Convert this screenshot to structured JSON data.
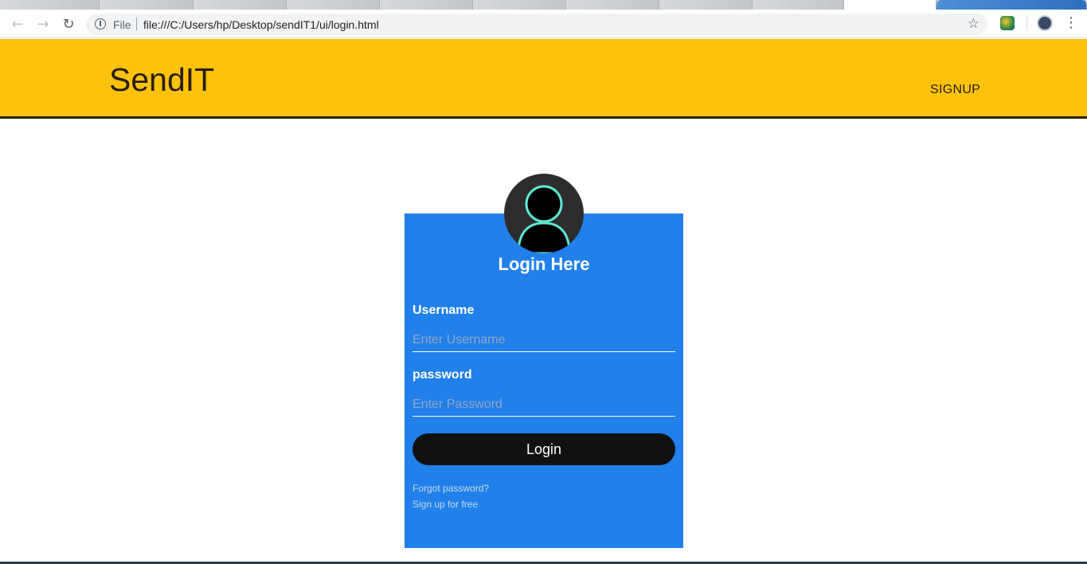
{
  "browser": {
    "back_icon": "arrow-left-icon",
    "forward_icon": "arrow-right-icon",
    "reload_icon": "reload-icon",
    "file_label": "File",
    "url": "file:///C:/Users/hp/Desktop/sendIT1/ui/login.html"
  },
  "header": {
    "brand": "SendIT",
    "signup_link": "SIGNUP",
    "background": "#fdc20b"
  },
  "login": {
    "title": "Login Here",
    "username_label": "Username",
    "username_placeholder": "Enter Username",
    "password_label": "password",
    "password_placeholder": "Enter Password",
    "button_label": "Login",
    "forgot_link": "Forgot password?",
    "signup_link": "Sign up for free",
    "card_color": "#2180ea",
    "avatar_icon": "user-avatar-icon"
  }
}
